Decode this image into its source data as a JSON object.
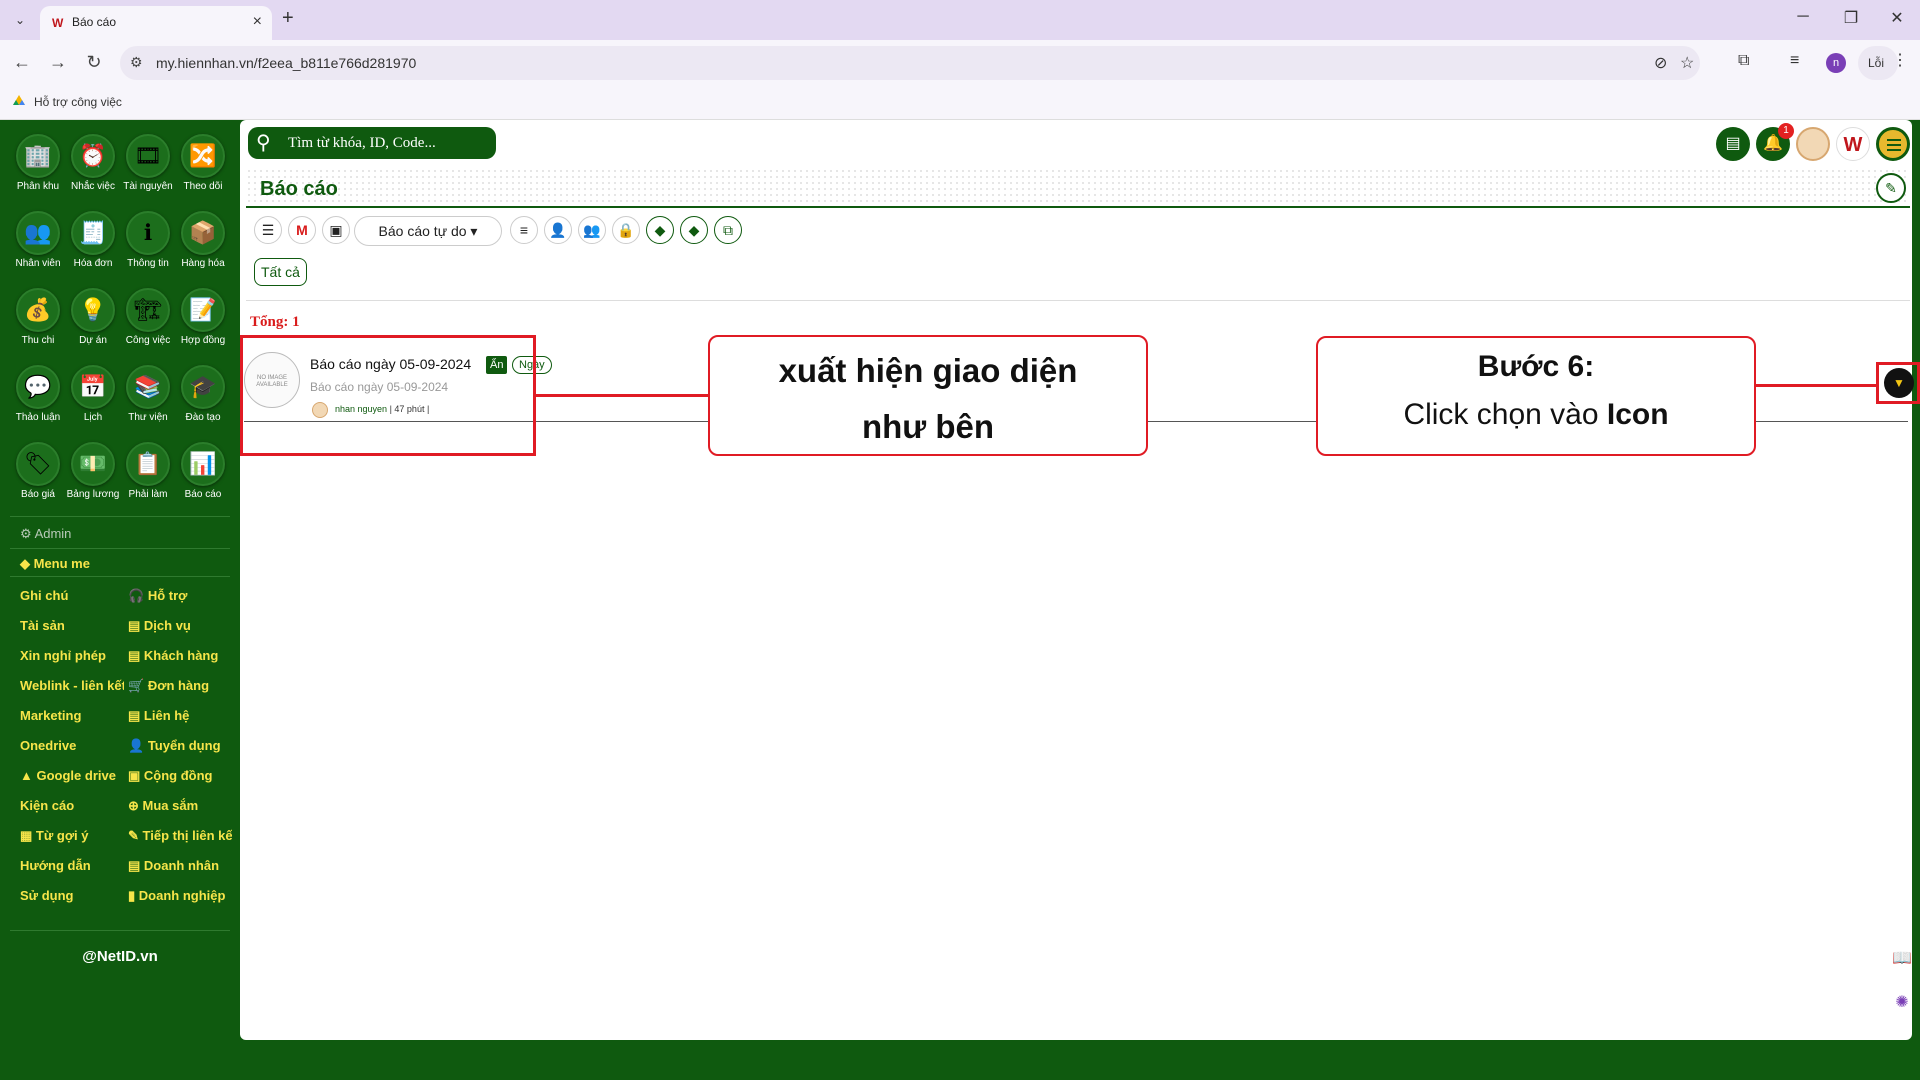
{
  "browser": {
    "tab_title": "Báo cáo",
    "url": "my.hiennhan.vn/f2eea_b811e766d281970",
    "profile_initial": "n",
    "error_label": "Lỗi",
    "bookmark_label": "Hỗ trợ công việc"
  },
  "search": {
    "placeholder": "Tìm từ khóa, ID, Code..."
  },
  "header": {
    "notification_count": "1"
  },
  "page": {
    "title": "Báo cáo",
    "report_select": "Báo cáo tự do ▾",
    "filter_all": "Tất cả",
    "total": "Tổng: 1"
  },
  "report_item": {
    "thumb_text": "NO IMAGE AVAILABLE",
    "title": "Báo cáo ngày 05-09-2024",
    "badge_hidden": "Ẩn",
    "badge_type": "Ngày",
    "subtitle": "Báo cáo ngày 05-09-2024",
    "author": "nhan nguyen",
    "time": "| 47 phút |"
  },
  "callouts": {
    "left_text_1": "xuất hiện giao diện",
    "left_text_2": "như bên",
    "right_title": "Bước 6:",
    "right_text": "Click chọn vào",
    "right_bold": "Icon"
  },
  "sidebar": {
    "apps": [
      {
        "label": "Phân khu",
        "icon": "building-icon"
      },
      {
        "label": "Nhắc việc",
        "icon": "alarm-icon"
      },
      {
        "label": "Tài nguyên",
        "icon": "media-icon"
      },
      {
        "label": "Theo dõi",
        "icon": "tracking-icon"
      },
      {
        "label": "Nhân viên",
        "icon": "people-icon"
      },
      {
        "label": "Hóa đơn",
        "icon": "invoice-icon"
      },
      {
        "label": "Thông tin",
        "icon": "info-icon"
      },
      {
        "label": "Hàng hóa",
        "icon": "goods-icon"
      },
      {
        "label": "Thu chi",
        "icon": "money-icon"
      },
      {
        "label": "Dự án",
        "icon": "project-icon"
      },
      {
        "label": "Công việc",
        "icon": "work-icon"
      },
      {
        "label": "Hợp đồng",
        "icon": "contract-icon"
      },
      {
        "label": "Thảo luận",
        "icon": "discussion-icon"
      },
      {
        "label": "Lịch",
        "icon": "calendar-icon"
      },
      {
        "label": "Thư viện",
        "icon": "library-icon"
      },
      {
        "label": "Đào tạo",
        "icon": "training-icon"
      },
      {
        "label": "Báo giá",
        "icon": "quote-icon"
      },
      {
        "label": "Bảng lương",
        "icon": "payroll-icon"
      },
      {
        "label": "Phải làm",
        "icon": "todo-icon"
      },
      {
        "label": "Báo cáo",
        "icon": "report-icon"
      }
    ],
    "admin": "Admin",
    "menu_me": "Menu me",
    "left_links": [
      "Ghi chú",
      "Tài sản",
      "Xin nghỉ phép",
      "Weblink - liên kết",
      "Marketing",
      "Onedrive",
      "Google drive",
      "Kiện cáo",
      "Từ gợi ý",
      "Hướng dẫn",
      "Sử dụng"
    ],
    "right_links": [
      "Hỗ trợ",
      "Dịch vụ",
      "Khách hàng",
      "Đơn hàng",
      "Liên hệ",
      "Tuyển dụng",
      "Cộng đồng",
      "Mua sắm",
      "Tiếp thị liên kết",
      "Doanh nhân",
      "Doanh nghiệp"
    ],
    "footer": "@NetID.vn"
  },
  "colors": {
    "brand_green": "#0f5a0f",
    "accent_yellow": "#f7e54a",
    "highlight_red": "#e01b24"
  }
}
